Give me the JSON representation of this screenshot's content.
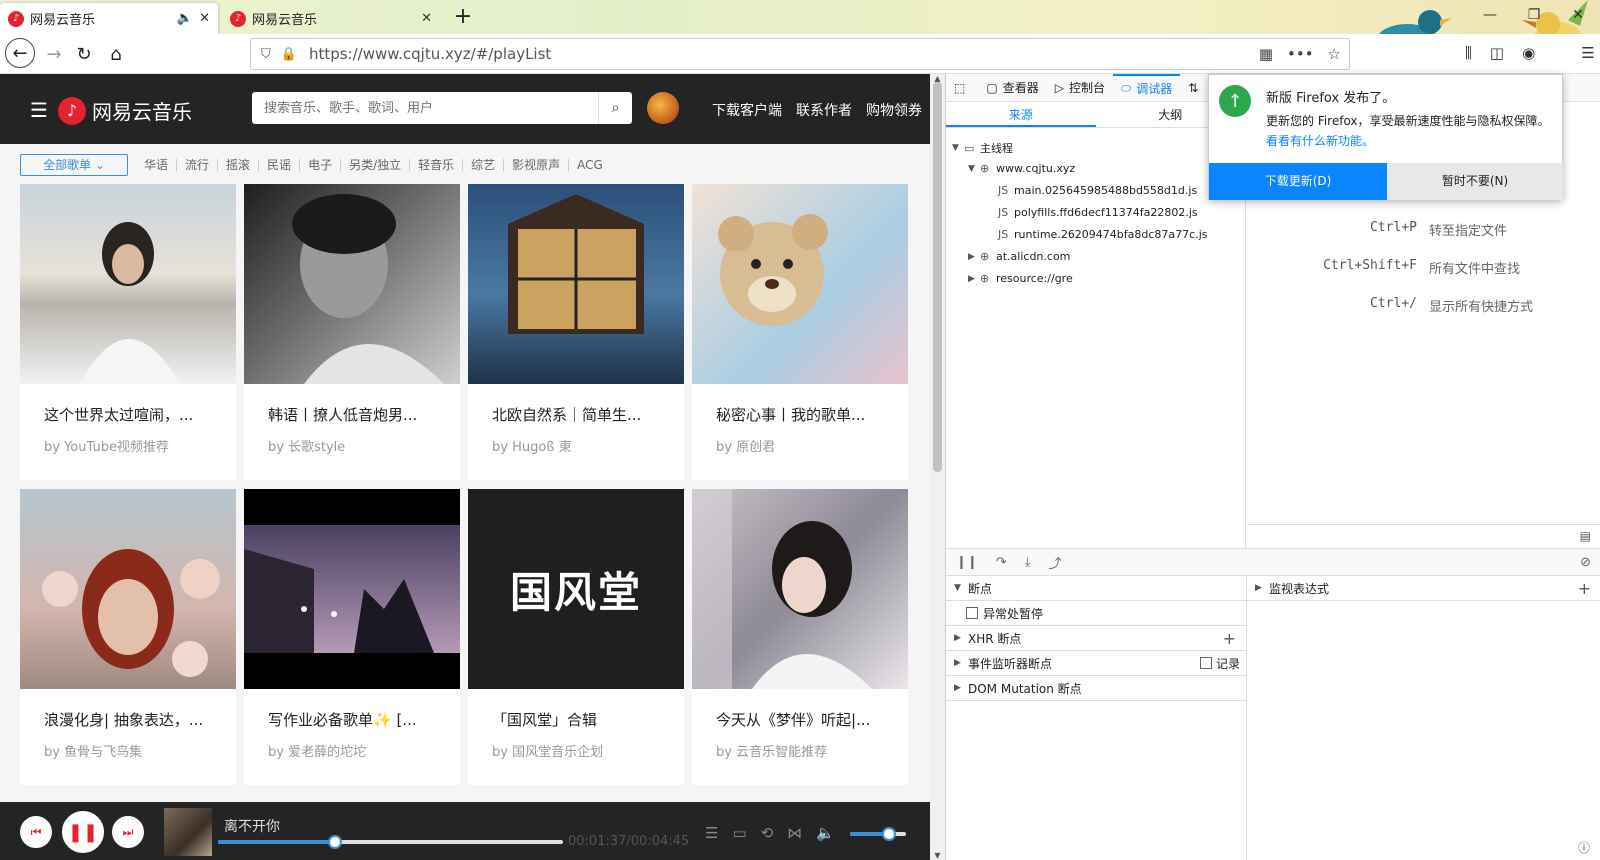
{
  "browser": {
    "tabs": [
      {
        "title": "网易云音乐",
        "active": true
      },
      {
        "title": "网易云音乐",
        "active": false
      }
    ],
    "new_tab_label": "+",
    "url": "https://www.cqjtu.xyz/#/playList",
    "window_controls": [
      "—",
      "❐",
      "✕"
    ]
  },
  "site": {
    "logo_text": "网易云音乐",
    "search_placeholder": "搜索音乐、歌手、歌词、用户",
    "header_links": [
      "下载客户端",
      "联系作者",
      "购物领券"
    ],
    "category_all": "全部歌单 ⌄",
    "categories": [
      "华语",
      "流行",
      "摇滚",
      "民谣",
      "电子",
      "另类/独立",
      "轻音乐",
      "综艺",
      "影视原声",
      "ACG"
    ],
    "playlists": [
      {
        "title": "这个世界太过喧闹，...",
        "author": "by YouTube视频推荐"
      },
      {
        "title": "韩语丨撩人低音炮男...",
        "author": "by 长歌style"
      },
      {
        "title": "北欧自然系｜简单生...",
        "author": "by Hugoß 東"
      },
      {
        "title": "秘密心事丨我的歌单...",
        "author": "by 原创君"
      },
      {
        "title": "浪漫化身| 抽象表达，...",
        "author": "by 鱼骨与飞鸟集"
      },
      {
        "title": "写作业必备歌单✨ [...",
        "author": "by 爱老薛的坨坨"
      },
      {
        "title": "「国风堂」合辑",
        "author": "by 国风堂音乐企划"
      },
      {
        "title": "今天从《梦伴》听起|...",
        "author": "by 云音乐智能推荐"
      }
    ],
    "cover_text_6": "国风堂"
  },
  "player": {
    "song_title": "离不开你",
    "time": "00:01:37/00:04:45",
    "progress": 0.34,
    "volume": 0.7
  },
  "devtools": {
    "tabs": [
      "查看器",
      "控制台",
      "调试器",
      "网络"
    ],
    "active_tab": "调试器",
    "subtabs": [
      "来源",
      "大纲"
    ],
    "tree": {
      "main_thread": "主线程",
      "host": "www.cqjtu.xyz",
      "files": [
        "main.025645985488bd558d1d.js",
        "polyfills.ffd6decf11374fa22802.js",
        "runtime.26209474bfa8dc87a77c.js"
      ],
      "other_hosts": [
        "at.alicdn.com",
        "resource://gre"
      ]
    },
    "shortcuts": [
      {
        "keys": "Ctrl+P",
        "desc": "转至指定文件"
      },
      {
        "keys": "Ctrl+Shift+F",
        "desc": "所有文件中查找"
      },
      {
        "keys": "Ctrl+/",
        "desc": "显示所有快捷方式"
      }
    ],
    "breakpoints_label": "断点",
    "pause_on_exceptions": "异常处暂停",
    "xhr_breakpoints": "XHR 断点",
    "event_listener_breakpoints": "事件监听器断点",
    "log_label": "记录",
    "dom_mutation": "DOM Mutation 断点",
    "watch_expressions": "监视表达式"
  },
  "notification": {
    "title": "新版 Firefox 发布了。",
    "body": "更新您的 Firefox，享受最新速度性能与隐私权保障。",
    "link": "看看有什么新功能。",
    "primary": "下载更新(D)",
    "secondary": "暂时不要(N)"
  },
  "colors": {
    "accent": "#0a84ff",
    "brand_red": "#e4232e",
    "header_bg": "#242424"
  }
}
